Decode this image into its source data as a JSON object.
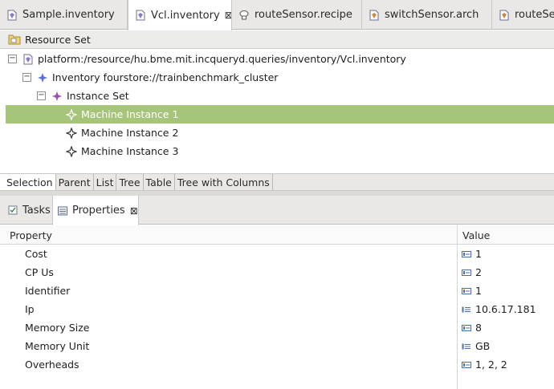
{
  "editor_tabs": [
    {
      "label": "Sample.inventory",
      "icon": "inventory-file-icon",
      "active": false
    },
    {
      "label": "Vcl.inventory",
      "icon": "inventory-file-icon",
      "active": true,
      "close": "⊠"
    },
    {
      "label": "routeSensor.recipe",
      "icon": "recipe-file-icon",
      "active": false
    },
    {
      "label": "switchSensor.arch",
      "icon": "arch-file-icon",
      "active": false
    },
    {
      "label": "routeSen",
      "icon": "inventory-file-icon",
      "active": false
    }
  ],
  "resource_set": {
    "label": "Resource Set",
    "icon": "resource-set-icon"
  },
  "tree": {
    "resource": "platform:/resource/hu.bme.mit.incqueryd.queries/inventory/Vcl.inventory",
    "inventory": "Inventory fourstore://trainbenchmark_cluster",
    "instance_set": "Instance Set",
    "machines": [
      "Machine Instance 1",
      "Machine Instance 2",
      "Machine Instance 3"
    ],
    "selected_index": 0
  },
  "viewer_tabs": [
    "Selection",
    "Parent",
    "List",
    "Tree",
    "Table",
    "Tree with Columns"
  ],
  "view_tabs": [
    {
      "label": "Tasks",
      "icon": "tasks-icon",
      "active": false
    },
    {
      "label": "Properties",
      "icon": "properties-icon",
      "active": true,
      "close": "⊠"
    }
  ],
  "properties": {
    "header": {
      "property": "Property",
      "value": "Value"
    },
    "rows": [
      {
        "name": "Cost",
        "value": "1",
        "icon": "number-attribute-icon"
      },
      {
        "name": "CP Us",
        "value": "2",
        "icon": "number-attribute-icon"
      },
      {
        "name": "Identifier",
        "value": "1",
        "icon": "number-attribute-icon"
      },
      {
        "name": "Ip",
        "value": "10.6.17.181",
        "icon": "text-attribute-icon"
      },
      {
        "name": "Memory Size",
        "value": "8",
        "icon": "number-attribute-icon"
      },
      {
        "name": "Memory Unit",
        "value": "GB",
        "icon": "enum-attribute-icon"
      },
      {
        "name": "Overheads",
        "value": "1, 2, 2",
        "icon": "list-attribute-icon"
      }
    ]
  },
  "colors": {
    "selection": "#a6c57a",
    "tab_bar": "#e9e8e6"
  }
}
